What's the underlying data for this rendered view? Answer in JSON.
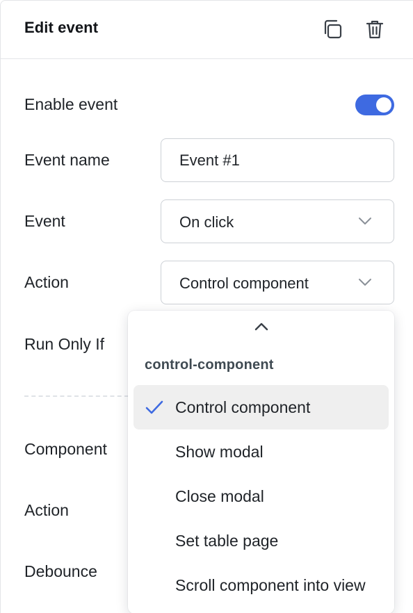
{
  "header": {
    "title": "Edit event",
    "copy_icon": "copy-icon",
    "trash_icon": "trash-icon"
  },
  "form": {
    "enable_event": {
      "label": "Enable event",
      "enabled": true
    },
    "event_name": {
      "label": "Event name",
      "value": "Event #1"
    },
    "event": {
      "label": "Event",
      "value": "On click"
    },
    "action": {
      "label": "Action",
      "value": "Control component"
    },
    "run_only_if": {
      "label": "Run Only If"
    },
    "component": {
      "label": "Component"
    },
    "action2": {
      "label": "Action"
    },
    "debounce": {
      "label": "Debounce"
    }
  },
  "dropdown": {
    "group_label": "control-component",
    "items": [
      {
        "label": "Control component",
        "selected": true
      },
      {
        "label": "Show modal",
        "selected": false
      },
      {
        "label": "Close modal",
        "selected": false
      },
      {
        "label": "Set table page",
        "selected": false
      },
      {
        "label": "Scroll component into view",
        "selected": false
      }
    ]
  },
  "colors": {
    "accent": "#3e6ae1",
    "selected_bg": "#efefef",
    "border": "#cdd1d6"
  }
}
